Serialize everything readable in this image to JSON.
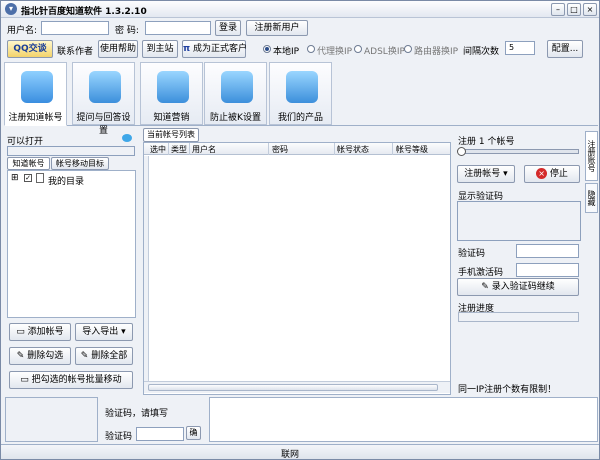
{
  "title": "指北针百度知道软件 1.3.2.10",
  "login": {
    "user_label": "用户名:",
    "pass_label": "密  码:",
    "login_btn": "登录",
    "register_btn": "注册新用户"
  },
  "toolbar": {
    "qq_btn": "QQ交谈",
    "contact": "联系作者",
    "help": "使用帮助",
    "site": "到主站",
    "vip": "成为正式客户",
    "ip_local": "本地IP",
    "ip_proxy": "代理换IP",
    "ip_adsl": "ADSL换IP",
    "ip_router": "路由器换IP",
    "retry_label": "间隔次数",
    "retry_value": "5",
    "config": "配置..."
  },
  "tabs": [
    {
      "label": "注册知道帐号"
    },
    {
      "label": "提问与回答设置"
    },
    {
      "label": "知道营销"
    },
    {
      "label": "防止被K设置"
    },
    {
      "label": "我们的产品"
    }
  ],
  "left": {
    "open_label": "可以打开",
    "subtab1": "知道帐号",
    "subtab2": "帐号移动目标",
    "tree_root": "我的目录",
    "add": "添加帐号",
    "import": "导入导出",
    "del_checked": "删除勾选",
    "del_all": "删除全部",
    "batch_move": "把勾选的帐号批量移动"
  },
  "list": {
    "tab": "当前帐号列表",
    "columns": [
      "选中",
      "类型",
      "用户名",
      "密码",
      "帐号状态",
      "帐号等级"
    ]
  },
  "right": {
    "reg_count": "注册 1 个帐号",
    "reg_btn": "注册帐号",
    "stop_btn": "停止",
    "show_captcha": "显示验证码",
    "captcha_label": "验证码",
    "phone_label": "手机激活码",
    "enter_btn": "录入验证码继续",
    "progress_label": "注册进度",
    "note": "同一IP注册个数有限制！",
    "vtab1": "注册账号",
    "vtab2": "隐藏"
  },
  "bottom": {
    "prompt": "验证码，请填写",
    "captcha_label": "验证码",
    "ok": "确"
  },
  "status": {
    "net": "联网"
  }
}
